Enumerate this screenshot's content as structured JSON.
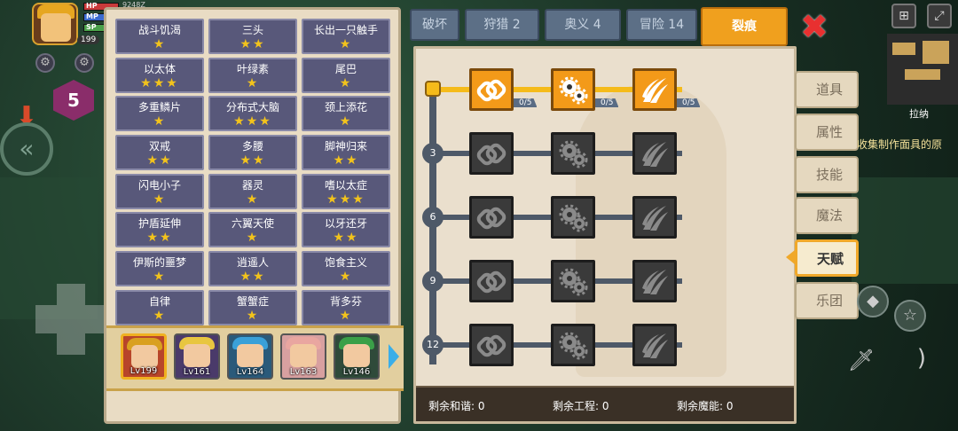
{
  "hud": {
    "hp_label": "HP",
    "mp_label": "MP",
    "sp_label": "SP",
    "coins": "9248Z",
    "player_level": "199",
    "stage_badge": "5"
  },
  "talents": [
    {
      "name": "战斗饥渴",
      "stars": "★"
    },
    {
      "name": "三头",
      "stars": "★★"
    },
    {
      "name": "长出一只触手",
      "stars": "★"
    },
    {
      "name": "以太体",
      "stars": "★★★"
    },
    {
      "name": "叶绿素",
      "stars": "★"
    },
    {
      "name": "尾巴",
      "stars": "★"
    },
    {
      "name": "多重鳞片",
      "stars": "★"
    },
    {
      "name": "分布式大脑",
      "stars": "★★★"
    },
    {
      "name": "颈上添花",
      "stars": "★"
    },
    {
      "name": "双戒",
      "stars": "★★"
    },
    {
      "name": "多腰",
      "stars": "★★"
    },
    {
      "name": "脚神归来",
      "stars": "★★"
    },
    {
      "name": "闪电小子",
      "stars": "★"
    },
    {
      "name": "器灵",
      "stars": "★"
    },
    {
      "name": "嗜以太症",
      "stars": "★★★"
    },
    {
      "name": "护盾延伸",
      "stars": "★★"
    },
    {
      "name": "六翼天使",
      "stars": "★"
    },
    {
      "name": "以牙还牙",
      "stars": "★★"
    },
    {
      "name": "伊斯的噩梦",
      "stars": "★"
    },
    {
      "name": "逍遥人",
      "stars": "★★"
    },
    {
      "name": "饱食主义",
      "stars": "★"
    },
    {
      "name": "自律",
      "stars": "★"
    },
    {
      "name": "蟹蟹症",
      "stars": "★"
    },
    {
      "name": "背多芬",
      "stars": "★"
    }
  ],
  "heroes": [
    {
      "level": "Lv199",
      "hair": "#d9a020",
      "bg": "#b8452a"
    },
    {
      "level": "Lv161",
      "hair": "#e8c640",
      "bg": "#4a3a6a"
    },
    {
      "level": "Lv164",
      "hair": "#3aa0d8",
      "bg": "#2a5a7a"
    },
    {
      "level": "Lv163",
      "hair": "#e9a6a0",
      "bg": "#d8a0a0"
    },
    {
      "level": "Lv146",
      "hair": "#3aa048",
      "bg": "#2f4a3a"
    }
  ],
  "tabs": [
    {
      "label": "破坏"
    },
    {
      "label": "狩猎 2"
    },
    {
      "label": "奥义 4"
    },
    {
      "label": "冒险 14"
    },
    {
      "label": "裂痕"
    }
  ],
  "tree": {
    "row_levels": [
      "3",
      "6",
      "9",
      "12"
    ],
    "node_icons": [
      "chain-link-icon",
      "gears-icon",
      "claw-slash-icon"
    ],
    "unlocked_counts": [
      "0/5",
      "0/5",
      "0/5"
    ],
    "accent": "#f39a19"
  },
  "remaining": {
    "harmony": "剩余和谐: 0",
    "engineering": "剩余工程: 0",
    "magic": "剩余魔能: 0"
  },
  "side_menu": [
    {
      "label": "道具"
    },
    {
      "label": "属性"
    },
    {
      "label": "技能"
    },
    {
      "label": "魔法"
    },
    {
      "label": "天赋"
    },
    {
      "label": "乐团"
    }
  ],
  "minimap": {
    "location": "拉纳"
  },
  "hint": "收集制作面具的原"
}
